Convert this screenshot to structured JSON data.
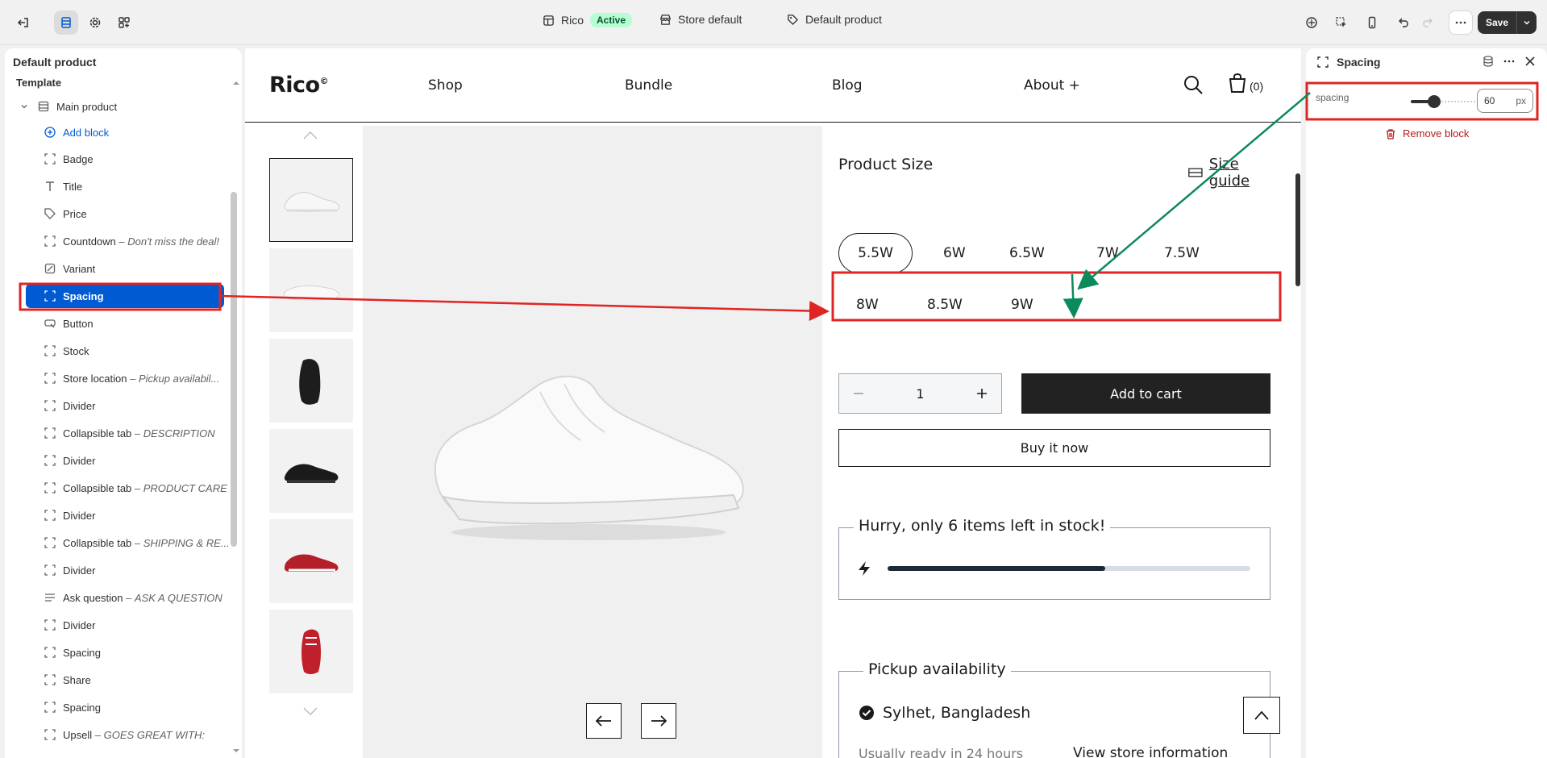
{
  "topbar": {
    "theme_name": "Rico",
    "theme_status": "Active",
    "store_label": "Store default",
    "template_label": "Default product",
    "save_label": "Save"
  },
  "left_panel": {
    "title": "Default product",
    "section": "Template",
    "group": "Main product",
    "add_block": "Add block",
    "items": [
      {
        "label": "Badge",
        "note": ""
      },
      {
        "label": "Title",
        "note": ""
      },
      {
        "label": "Price",
        "note": ""
      },
      {
        "label": "Countdown",
        "note": "Don't miss the deal!"
      },
      {
        "label": "Variant",
        "note": ""
      },
      {
        "label": "Spacing",
        "note": ""
      },
      {
        "label": "Button",
        "note": ""
      },
      {
        "label": "Stock",
        "note": ""
      },
      {
        "label": "Store location",
        "note": "Pickup availabil..."
      },
      {
        "label": "Divider",
        "note": ""
      },
      {
        "label": "Collapsible tab",
        "note": "DESCRIPTION"
      },
      {
        "label": "Divider",
        "note": ""
      },
      {
        "label": "Collapsible tab",
        "note": "PRODUCT CARE"
      },
      {
        "label": "Divider",
        "note": ""
      },
      {
        "label": "Collapsible tab",
        "note": "SHIPPING & RE..."
      },
      {
        "label": "Divider",
        "note": ""
      },
      {
        "label": "Ask question",
        "note": "ASK A QUESTION"
      },
      {
        "label": "Divider",
        "note": ""
      },
      {
        "label": "Spacing",
        "note": ""
      },
      {
        "label": "Share",
        "note": ""
      },
      {
        "label": "Spacing",
        "note": ""
      },
      {
        "label": "Upsell",
        "note": "GOES GREAT WITH:"
      }
    ],
    "note_separator": " – "
  },
  "preview": {
    "logo": "Rico",
    "logo_mark": "©",
    "nav": [
      "Shop",
      "Bundle",
      "Blog",
      "About +"
    ],
    "cart_count": "(0)",
    "size_heading": "Product Size",
    "size_guide": "Size guide",
    "sizes": [
      "5.5W",
      "6W",
      "6.5W",
      "7W",
      "7.5W",
      "8W",
      "8.5W",
      "9W"
    ],
    "selected_size": "5.5W",
    "quantity": "1",
    "add_to_cart": "Add to cart",
    "buy_now": "Buy it now",
    "stock_message": "Hurry, only 6 items left in stock!",
    "stock_level": 0.6,
    "pickup_title": "Pickup availability",
    "pickup_location": "Sylhet, Bangladesh",
    "pickup_ready": "Usually ready in 24 hours",
    "pickup_link": "View store information"
  },
  "right_panel": {
    "title": "Spacing",
    "setting_label": "spacing",
    "setting_value": "60",
    "setting_unit": "px",
    "remove_block": "Remove block"
  },
  "colors": {
    "accent": "#005bd3",
    "annotation_red": "#e02424",
    "annotation_green": "#0b8a5b"
  }
}
